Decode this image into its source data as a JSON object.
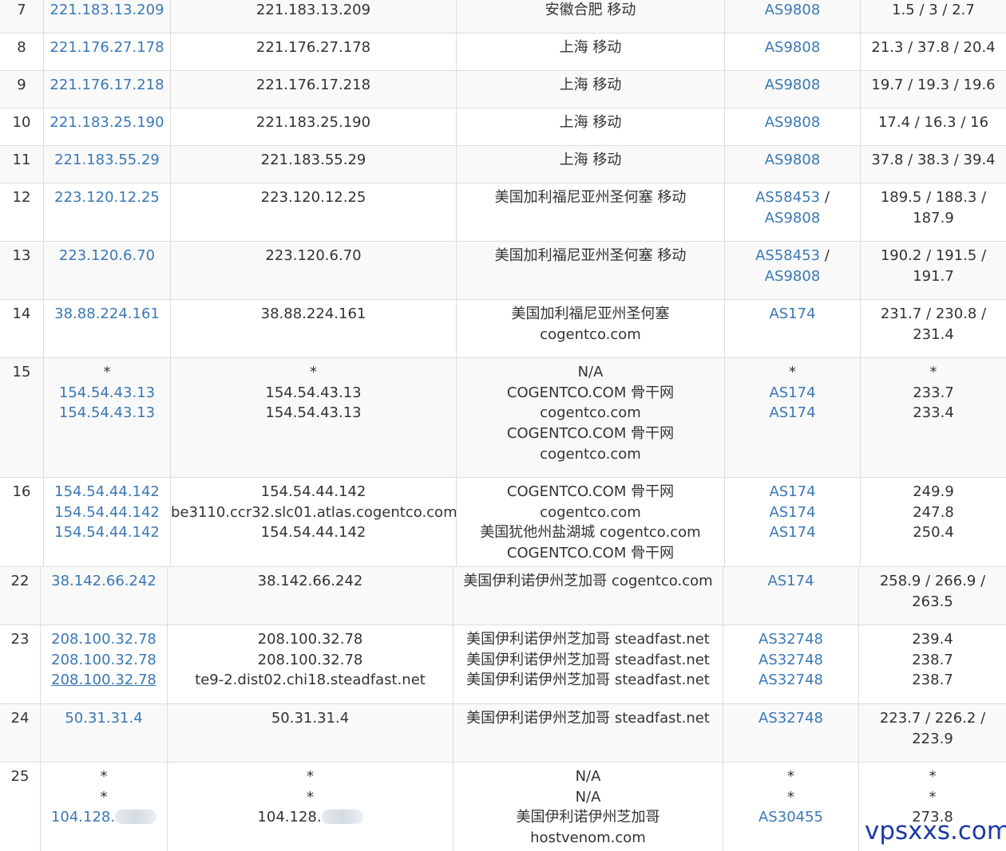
{
  "hops": [
    {
      "hop": "7",
      "ip": [
        "221.183.13.209"
      ],
      "host": [
        "221.183.13.209"
      ],
      "geo": [
        "安徽合肥 移动"
      ],
      "asn": [
        "AS9808"
      ],
      "latency": [
        "1.5 / 3 / 2.7"
      ]
    },
    {
      "hop": "8",
      "ip": [
        "221.176.27.178"
      ],
      "host": [
        "221.176.27.178"
      ],
      "geo": [
        "上海 移动"
      ],
      "asn": [
        "AS9808"
      ],
      "latency": [
        "21.3 / 37.8 / 20.4"
      ]
    },
    {
      "hop": "9",
      "ip": [
        "221.176.17.218"
      ],
      "host": [
        "221.176.17.218"
      ],
      "geo": [
        "上海 移动"
      ],
      "asn": [
        "AS9808"
      ],
      "latency": [
        "19.7 / 19.3 / 19.6"
      ]
    },
    {
      "hop": "10",
      "ip": [
        "221.183.25.190"
      ],
      "host": [
        "221.183.25.190"
      ],
      "geo": [
        "上海 移动"
      ],
      "asn": [
        "AS9808"
      ],
      "latency": [
        "17.4 / 16.3 / 16"
      ]
    },
    {
      "hop": "11",
      "ip": [
        "221.183.55.29"
      ],
      "host": [
        "221.183.55.29"
      ],
      "geo": [
        "上海 移动"
      ],
      "asn": [
        "AS9808"
      ],
      "latency": [
        "37.8 / 38.3 / 39.4"
      ]
    },
    {
      "hop": "12",
      "ip": [
        "223.120.12.25"
      ],
      "host": [
        "223.120.12.25"
      ],
      "geo": [
        "美国加利福尼亚州圣何塞 移动"
      ],
      "asn": [
        "AS58453 /",
        "AS9808"
      ],
      "latency": [
        "189.5 / 188.3 /",
        "187.9"
      ]
    },
    {
      "hop": "13",
      "ip": [
        "223.120.6.70"
      ],
      "host": [
        "223.120.6.70"
      ],
      "geo": [
        "美国加利福尼亚州圣何塞 移动"
      ],
      "asn": [
        "AS58453 /",
        "AS9808"
      ],
      "latency": [
        "190.2 / 191.5 /",
        "191.7"
      ]
    },
    {
      "hop": "14",
      "ip": [
        "38.88.224.161"
      ],
      "host": [
        "38.88.224.161"
      ],
      "geo": [
        "美国加利福尼亚州圣何塞",
        "cogentco.com"
      ],
      "asn": [
        "AS174"
      ],
      "latency": [
        "231.7 / 230.8 /",
        "231.4"
      ]
    },
    {
      "hop": "15",
      "ip": [
        "*",
        "154.54.43.13",
        "154.54.43.13"
      ],
      "host": [
        "*",
        "154.54.43.13",
        "154.54.43.13"
      ],
      "geo": [
        "N/A",
        "COGENTCO.COM 骨干网",
        "cogentco.com",
        "COGENTCO.COM 骨干网",
        "cogentco.com"
      ],
      "asn": [
        "*",
        "AS174",
        "AS174"
      ],
      "latency": [
        "*",
        "233.7",
        "233.4"
      ]
    },
    {
      "hop": "16",
      "ip": [
        "154.54.44.142",
        "154.54.44.142",
        "154.54.44.142"
      ],
      "host": [
        "154.54.44.142",
        "be3110.ccr32.slc01.atlas.cogentco.com",
        "154.54.44.142"
      ],
      "geo": [
        "COGENTCO.COM 骨干网",
        "cogentco.com",
        "美国犹他州盐湖城 cogentco.com",
        "COGENTCO.COM 骨干网"
      ],
      "asn": [
        "AS174",
        "AS174",
        "AS174"
      ],
      "latency": [
        "249.9",
        "247.8",
        "250.4"
      ]
    },
    {
      "hop": "22",
      "ip": [
        "38.142.66.242"
      ],
      "host": [
        "38.142.66.242"
      ],
      "geo": [
        "美国伊利诺伊州芝加哥 cogentco.com"
      ],
      "asn": [
        "AS174"
      ],
      "latency": [
        "258.9 / 266.9 /",
        "263.5"
      ]
    },
    {
      "hop": "23",
      "ip": [
        "208.100.32.78",
        "208.100.32.78",
        "208.100.32.78"
      ],
      "host": [
        "208.100.32.78",
        "208.100.32.78",
        "te9-2.dist02.chi18.steadfast.net"
      ],
      "geo": [
        "美国伊利诺伊州芝加哥 steadfast.net",
        "美国伊利诺伊州芝加哥 steadfast.net",
        "美国伊利诺伊州芝加哥 steadfast.net"
      ],
      "asn": [
        "AS32748",
        "AS32748",
        "AS32748"
      ],
      "latency": [
        "239.4",
        "238.7",
        "238.7"
      ]
    },
    {
      "hop": "24",
      "ip": [
        "50.31.31.4"
      ],
      "host": [
        "50.31.31.4"
      ],
      "geo": [
        "美国伊利诺伊州芝加哥 steadfast.net"
      ],
      "asn": [
        "AS32748"
      ],
      "latency": [
        "223.7 / 226.2 /",
        "223.9"
      ]
    },
    {
      "hop": "25",
      "ip": [
        "*",
        "*",
        "104.128."
      ],
      "host": [
        "*",
        "*",
        "104.128."
      ],
      "geo": [
        "N/A",
        "N/A",
        "美国伊利诺伊州芝加哥",
        "hostvenom.com"
      ],
      "asn": [
        "*",
        "*",
        "AS30455"
      ],
      "latency": [
        "*",
        "*",
        "273.8"
      ]
    }
  ],
  "watermark": "vpsxxs.com",
  "colors": {
    "link": "#3a78b5",
    "text": "#333333",
    "border": "#dddddd",
    "stripe": "#f9f9f9",
    "watermark": "#1e3aa8"
  }
}
